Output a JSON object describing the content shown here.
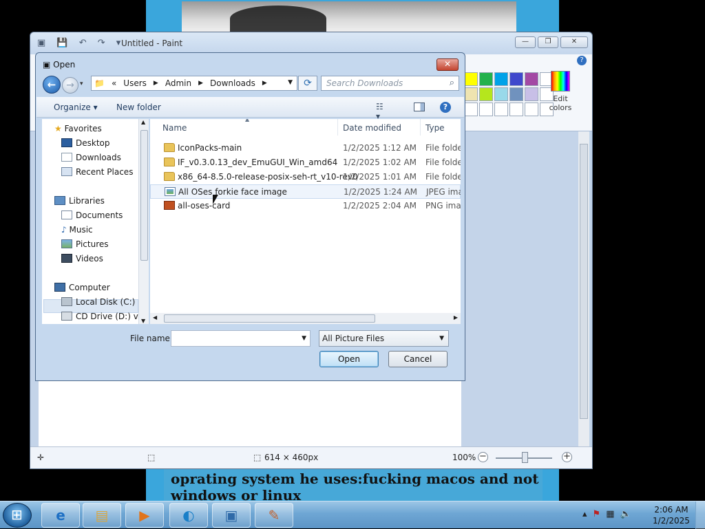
{
  "background": {
    "caption": "oprating system he uses:fucking macos and not windows or linux"
  },
  "paint": {
    "title": "Untitled - Paint",
    "edit_colors_label": "Edit colors",
    "status": {
      "size": "614 × 460px",
      "zoom": "100%"
    },
    "palette": [
      "#ffff00",
      "#22b14c",
      "#00a2e8",
      "#3f48cc",
      "#a349a4",
      "#efe4b0",
      "#b5e61d",
      "#99d9ea",
      "#7092be",
      "#c8bfe7",
      "#ffffff",
      "#ffffff"
    ]
  },
  "dialog": {
    "title": "Open",
    "address": {
      "segments": [
        "Users",
        "Admin",
        "Downloads"
      ],
      "prefix": "«"
    },
    "search_placeholder": "Search Downloads",
    "toolbar": {
      "organize": "Organize ▾",
      "new_folder": "New folder"
    },
    "nav": {
      "favorites": "Favorites",
      "desktop": "Desktop",
      "downloads": "Downloads",
      "recent_places": "Recent Places",
      "libraries": "Libraries",
      "documents": "Documents",
      "music": "Music",
      "pictures": "Pictures",
      "videos": "Videos",
      "computer": "Computer",
      "local_disk": "Local Disk (C:)",
      "cd_drive": "CD Drive (D:) virt"
    },
    "columns": {
      "name": "Name",
      "date": "Date modified",
      "type": "Type"
    },
    "files": [
      {
        "name": "IconPacks-main",
        "date": "1/2/2025 1:12 AM",
        "type": "File folder"
      },
      {
        "name": "IF_v0.3.0.13_dev_EmuGUI_Win_amd64",
        "date": "1/2/2025 1:02 AM",
        "type": "File folder"
      },
      {
        "name": "x86_64-8.5.0-release-posix-seh-rt_v10-rev0",
        "date": "1/2/2025 1:01 AM",
        "type": "File folder"
      },
      {
        "name": "All OSes forkie face image",
        "date": "1/2/2025 1:24 AM",
        "type": "JPEG image"
      },
      {
        "name": "all-oses-card",
        "date": "1/2/2025 2:04 AM",
        "type": "PNG image"
      }
    ],
    "file_name_label": "File name:",
    "file_name_value": "",
    "filter": "All Picture Files",
    "open_label": "Open",
    "cancel_label": "Cancel"
  },
  "taskbar": {
    "time": "2:06 AM",
    "date": "1/2/2025"
  }
}
